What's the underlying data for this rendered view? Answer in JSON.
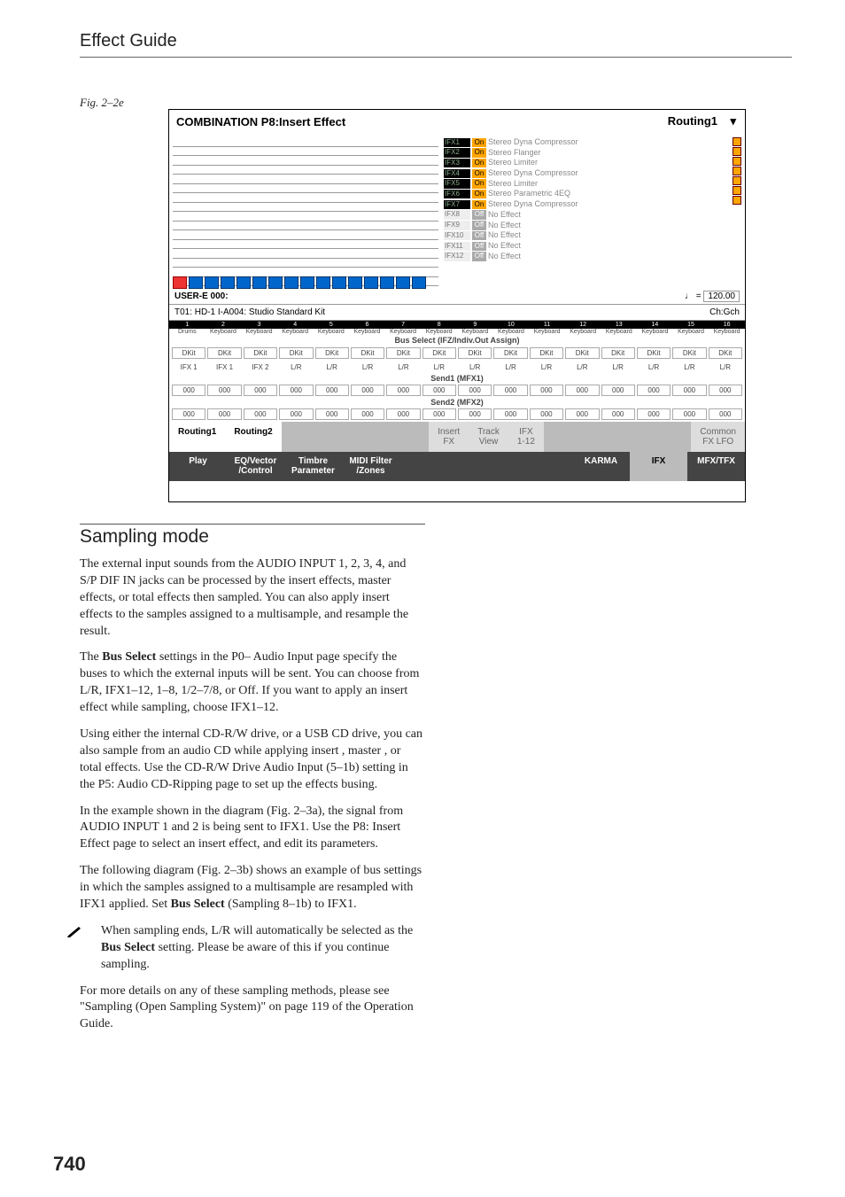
{
  "header": {
    "title": "Effect Guide"
  },
  "figure": {
    "label": "Fig. 2–2e"
  },
  "screenshot": {
    "title": "COMBINATION P8:Insert Effect",
    "dropdown": "Routing1",
    "dropdown_icon": "▾",
    "ifx_list": [
      {
        "slot": "IFX1",
        "state": "On",
        "name": "Stereo Dyna Compressor"
      },
      {
        "slot": "IFX2",
        "state": "On",
        "name": "Stereo Flanger"
      },
      {
        "slot": "IFX3",
        "state": "On",
        "name": "Stereo Limiter"
      },
      {
        "slot": "IFX4",
        "state": "On",
        "name": "Stereo Dyna Compressor"
      },
      {
        "slot": "IFX5",
        "state": "On",
        "name": "Stereo Limiter"
      },
      {
        "slot": "IFX6",
        "state": "On",
        "name": "Stereo Parametric 4EQ"
      },
      {
        "slot": "IFX7",
        "state": "On",
        "name": "Stereo Dyna Compressor"
      },
      {
        "slot": "IFX8",
        "state": "Off",
        "name": "No Effect"
      },
      {
        "slot": "IFX9",
        "state": "Off",
        "name": "No Effect"
      },
      {
        "slot": "IFX10",
        "state": "Off",
        "name": "No Effect"
      },
      {
        "slot": "IFX11",
        "state": "Off",
        "name": "No Effect"
      },
      {
        "slot": "IFX12",
        "state": "Off",
        "name": "No Effect"
      }
    ],
    "info": {
      "bank": "USER-E 000:",
      "tempo_label": "♩ =",
      "tempo_value": "120.00",
      "t01": "T01: HD-1 I-A004: Studio Standard Kit",
      "ch": "Ch:Gch"
    },
    "cat_first": "Drums",
    "cat_rest": "Keyboard",
    "bus_select_label": "Bus Select (IFZ/Indiv.Out Assign)",
    "bus_first": "DKit",
    "bus_rest": "DKit",
    "lr_first1": "IFX 1",
    "lr_first2": "IFX 2",
    "lr_rest": "L/R",
    "send1_label": "Send1 (MFX1)",
    "send2_label": "Send2 (MFX2)",
    "send_value": "000",
    "tabs_row1": [
      "Routing1",
      "Routing2",
      "Insert\nFX",
      "Track\nView",
      "IFX\n1-12",
      "Common\nFX LFO"
    ],
    "tabs_row2": [
      "Play",
      "EQ/Vector\n/Control",
      "Timbre\nParameter",
      "MIDI Filter\n/Zones",
      "",
      "",
      "",
      "KARMA",
      "IFX",
      "MFX/TFX"
    ]
  },
  "section": {
    "title": "Sampling mode"
  },
  "paragraphs": {
    "p1": "The external input sounds from the AUDIO INPUT 1, 2, 3, 4, and S/P DIF IN jacks can be processed by the insert effects, master effects, or total effects then sampled. You can also apply insert effects to the samples assigned to a multisample, and resample the result.",
    "p2a": "The ",
    "p2b": "Bus Select",
    "p2c": " settings in the P0– Audio Input page specify the buses to which the external inputs will be sent. You can choose from L/R, IFX1–12, 1–8, 1/2–7/8, or Off. If you want to apply an insert effect while sampling, choose IFX1–12.",
    "p3": "Using either the internal CD-R/W drive, or a USB CD drive, you can also sample from an audio CD while applying insert , master , or total effects. Use the CD-R/W Drive Audio Input (5–1b) setting in the P5: Audio CD-Ripping page to set up the effects busing.",
    "p4": "In the example shown in the diagram (Fig. 2–3a), the signal from AUDIO INPUT 1 and 2 is being sent to IFX1. Use the P8: Insert Effect page to select an insert effect, and edit its parameters.",
    "p5a": "The following diagram (Fig. 2–3b) shows an example of bus settings in which the samples assigned to a multisample are resampled with IFX1 applied. Set ",
    "p5b": "Bus Select",
    "p5c": " (Sampling 8–1b) to IFX1.",
    "note_a": "When sampling ends, L/R will automatically be selected as the ",
    "note_b": "Bus Select",
    "note_c": " setting. Please be aware of this if you continue sampling.",
    "p6": "For more details on any of these sampling methods, please see \"Sampling (Open Sampling System)\" on page 119 of the Operation Guide."
  },
  "page_number": "740"
}
